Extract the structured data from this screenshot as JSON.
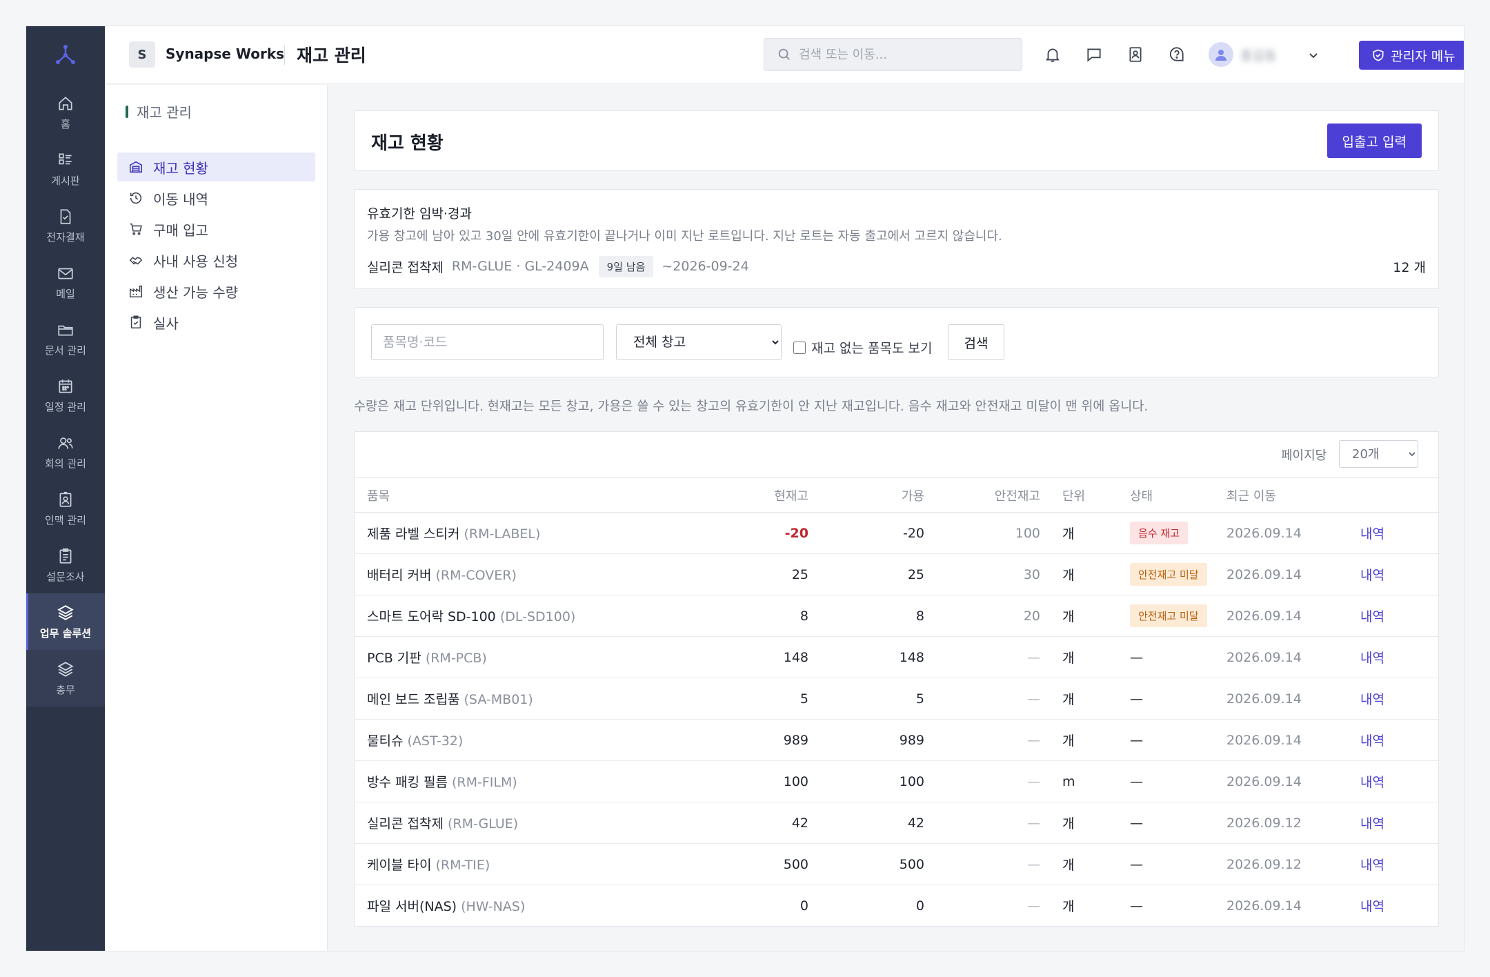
{
  "app": {
    "org_initial": "S",
    "org_name": "Synapse Works",
    "page_title": "재고 관리"
  },
  "header": {
    "search_placeholder": "검색 또는 이동...",
    "user_name": "홍길동",
    "admin_label": "관리자 메뉴",
    "icons": [
      "bell-icon",
      "chat-icon",
      "contacts-icon",
      "help-icon"
    ]
  },
  "rail": {
    "items": [
      {
        "label": "홈",
        "icon": "home-icon"
      },
      {
        "label": "게시판",
        "icon": "board-icon"
      },
      {
        "label": "전자결재",
        "icon": "approval-icon"
      },
      {
        "label": "메일",
        "icon": "mail-icon"
      },
      {
        "label": "문서 관리",
        "icon": "folder-icon"
      },
      {
        "label": "일정 관리",
        "icon": "calendar-icon"
      },
      {
        "label": "회의 관리",
        "icon": "people-icon"
      },
      {
        "label": "인맥 관리",
        "icon": "contact-card-icon"
      },
      {
        "label": "설문조사",
        "icon": "clipboard-icon"
      },
      {
        "label": "업무 솔루션",
        "icon": "layers-icon"
      },
      {
        "label": "총무",
        "icon": "layers-icon"
      }
    ]
  },
  "subnav": {
    "heading": "재고 관리",
    "items": [
      {
        "label": "재고 현황",
        "icon": "inventory-icon"
      },
      {
        "label": "이동 내역",
        "icon": "history-icon"
      },
      {
        "label": "구매 입고",
        "icon": "cart-icon"
      },
      {
        "label": "사내 사용 신청",
        "icon": "handshake-icon"
      },
      {
        "label": "생산 가능 수량",
        "icon": "factory-icon"
      },
      {
        "label": "실사",
        "icon": "clipboard-check-icon"
      }
    ]
  },
  "main": {
    "title": "재고 현황",
    "io_button": "입출고 입력",
    "expiry": {
      "title": "유효기한 임박·경과",
      "description": "가용 창고에 남아 있고 30일 안에 유효기한이 끝나거나 이미 지난 로트입니다. 지난 로트는 자동 출고에서 고르지 않습니다.",
      "item_name": "실리콘 접착제",
      "lot": "RM-GLUE · GL-2409A",
      "badge": "9일 남음",
      "date": "~2026-09-24",
      "count": "12 개"
    },
    "filters": {
      "search_placeholder": "품목명·코드",
      "warehouse_selected": "전체 창고",
      "show_empty_label": "재고 없는 품목도 보기",
      "search_button": "검색"
    },
    "note": "수량은 재고 단위입니다. 현재고는 모든 창고, 가용은 쓸 수 있는 창고의 유효기한이 안 지난 재고입니다. 음수 재고와 안전재고 미달이 맨 위에 옵니다.",
    "table": {
      "per_page_label": "페이지당",
      "per_page_value": "20개",
      "columns": [
        "품목",
        "현재고",
        "가용",
        "안전재고",
        "단위",
        "상태",
        "최근 이동",
        ""
      ],
      "rows": [
        {
          "name": "제품 라벨 스티커",
          "code": "(RM-LABEL)",
          "current": "-20",
          "available": "-20",
          "safety": "100",
          "unit": "개",
          "status": "음수 재고",
          "status_type": "danger",
          "last_move": "2026.09.14",
          "link": "내역"
        },
        {
          "name": "배터리 커버",
          "code": "(RM-COVER)",
          "current": "25",
          "available": "25",
          "safety": "30",
          "unit": "개",
          "status": "안전재고 미달",
          "status_type": "warn",
          "last_move": "2026.09.14",
          "link": "내역"
        },
        {
          "name": "스마트 도어락 SD-100",
          "code": "(DL-SD100)",
          "current": "8",
          "available": "8",
          "safety": "20",
          "unit": "개",
          "status": "안전재고 미달",
          "status_type": "warn",
          "last_move": "2026.09.14",
          "link": "내역"
        },
        {
          "name": "PCB 기판",
          "code": "(RM-PCB)",
          "current": "148",
          "available": "148",
          "safety": "—",
          "unit": "개",
          "status": "—",
          "status_type": "none",
          "last_move": "2026.09.14",
          "link": "내역"
        },
        {
          "name": "메인 보드 조립품",
          "code": "(SA-MB01)",
          "current": "5",
          "available": "5",
          "safety": "—",
          "unit": "개",
          "status": "—",
          "status_type": "none",
          "last_move": "2026.09.14",
          "link": "내역"
        },
        {
          "name": "물티슈",
          "code": "(AST-32)",
          "current": "989",
          "available": "989",
          "safety": "—",
          "unit": "개",
          "status": "—",
          "status_type": "none",
          "last_move": "2026.09.14",
          "link": "내역"
        },
        {
          "name": "방수 패킹 필름",
          "code": "(RM-FILM)",
          "current": "100",
          "available": "100",
          "safety": "—",
          "unit": "m",
          "status": "—",
          "status_type": "none",
          "last_move": "2026.09.14",
          "link": "내역"
        },
        {
          "name": "실리콘 접착제",
          "code": "(RM-GLUE)",
          "current": "42",
          "available": "42",
          "safety": "—",
          "unit": "개",
          "status": "—",
          "status_type": "none",
          "last_move": "2026.09.12",
          "link": "내역"
        },
        {
          "name": "케이블 타이",
          "code": "(RM-TIE)",
          "current": "500",
          "available": "500",
          "safety": "—",
          "unit": "개",
          "status": "—",
          "status_type": "none",
          "last_move": "2026.09.12",
          "link": "내역"
        },
        {
          "name": "파일 서버(NAS)",
          "code": "(HW-NAS)",
          "current": "0",
          "available": "0",
          "safety": "—",
          "unit": "개",
          "status": "—",
          "status_type": "none",
          "last_move": "2026.09.14",
          "link": "내역"
        }
      ]
    }
  },
  "colors": {
    "accent": "#4b3fd6",
    "rail_bg": "#2c3447",
    "danger": "#c0262d",
    "warn": "#b85f0c"
  }
}
